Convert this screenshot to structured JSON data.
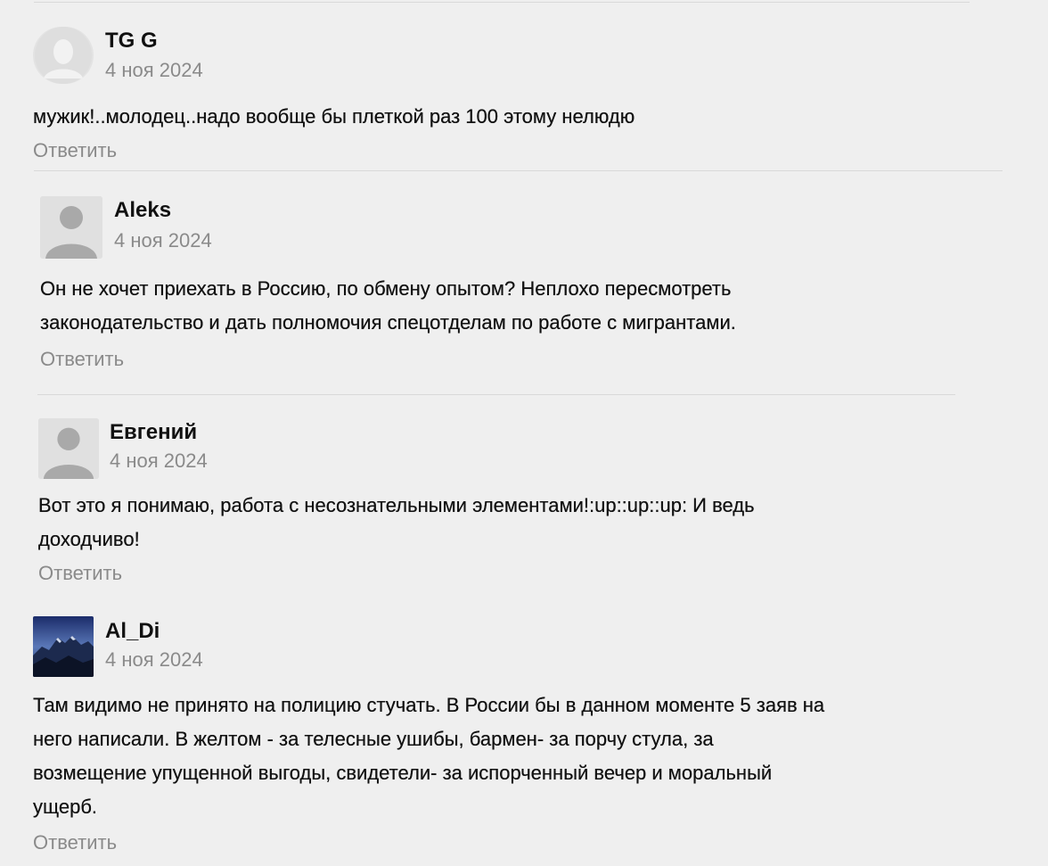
{
  "comments": [
    {
      "author": "TG G",
      "date": "4 ноя 2024",
      "avatar": "user-placeholder-icon",
      "lines": [
        "мужик!..молодец..надо вообще бы плеткой раз 100 этому нелюдю"
      ],
      "reply_label": "Ответить"
    },
    {
      "author": "Aleks",
      "date": "4 ноя 2024",
      "avatar": "user-placeholder-icon",
      "lines": [
        "Он не хочет приехать в Россию, по обмену опытом? Неплохо пересмотреть",
        "законодательство и дать полномочия спецотделам по работе с мигрантами."
      ],
      "reply_label": "Ответить"
    },
    {
      "author": "Евгений",
      "date": "4 ноя 2024",
      "avatar": "user-placeholder-icon",
      "lines": [
        "Вот это я понимаю, работа с несознательными элементами!:up::up::up: И ведь",
        "доходчиво!"
      ],
      "reply_label": "Ответить"
    },
    {
      "author": "Al_Di",
      "date": "4 ноя 2024",
      "avatar": "mountain-photo",
      "lines": [
        "Там видимо не принято на полицию стучать. В России бы в данном моменте 5 заяв на",
        "него написали. В желтом - за телесные ушибы, бармен- за порчу стула, за",
        "возмещение упущенной выгоды, свидетели- за испорченный вечер и моральный",
        "ущерб."
      ],
      "reply_label": "Ответить"
    }
  ]
}
